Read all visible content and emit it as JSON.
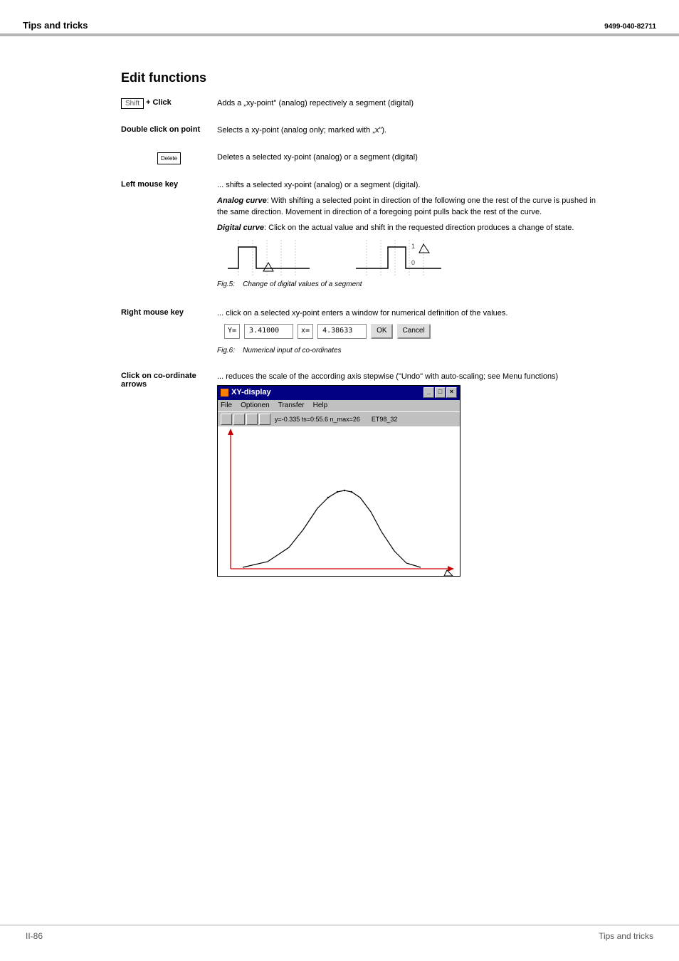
{
  "header": {
    "left": "Tips and tricks",
    "right": "9499-040-82711"
  },
  "section_title": "Edit functions",
  "shift": {
    "key": "Shift",
    "plus": "+ Click",
    "desc": "Adds a „xy-point\" (analog) repectively a segment (digital)"
  },
  "dbl": {
    "label": "Double click on point",
    "desc": "Selects a xy-point (analog only; marked with „x\")."
  },
  "del": {
    "key": "Delete",
    "desc": "Deletes a selected xy-point (analog) or a segment (digital)"
  },
  "leftmouse": {
    "label": "Left mouse key",
    "desc1": "... shifts a selected xy-point (analog) or a segment (digital).",
    "analog_label": "Analog curve",
    "analog_desc": ": With shifting a selected point in direction of the following one the rest of the curve is pushed in the same direction. Movement in direction of a foregoing point pulls back the rest of the curve.",
    "digital_label": "Digital curve",
    "digital_desc": ": Click on the actual value and shift in the requested direction produces a change of state.",
    "fig5": "Fig.5:",
    "fig5_caption": "Change of digital values of a segment"
  },
  "rightmouse": {
    "label": "Right mouse key",
    "desc": "... click on a selected xy-point enters a window for numerical definition of the values.",
    "y_label": "Y=",
    "y_val": "3.41000",
    "x_label": "x=",
    "x_val": "4.38633",
    "ok": "OK",
    "cancel": "Cancel",
    "fig6": "Fig.6:",
    "fig6_caption": "Numerical input of co-ordinates"
  },
  "coarrows": {
    "label": "Click on co-ordinate arrows",
    "desc": "... reduces the scale of the according axis stepwise (\"Undo\" with auto-scaling; see Menu functions)"
  },
  "xywin": {
    "title": "XY-display",
    "menu": [
      "File",
      "Optionen",
      "Transfer",
      "Help"
    ],
    "status": "y=-0.335  ts=0:55.6 n_max=26",
    "status2": "ET98_32"
  },
  "footer": {
    "left": "II-86",
    "right": "Tips and tricks"
  }
}
